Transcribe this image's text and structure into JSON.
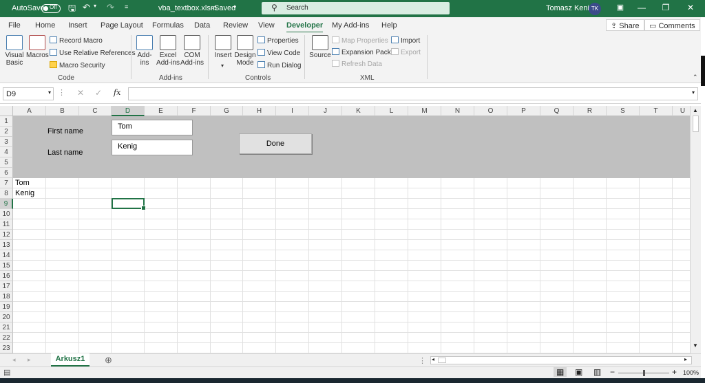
{
  "titlebar": {
    "autosave_label": "AutoSave",
    "autosave_state": "Off",
    "filename": "vba_textbox.xlsm",
    "saved_status": "Saved",
    "search_placeholder": "Search",
    "user_name": "Tomasz Kenig",
    "user_initials": "TK"
  },
  "tabs": [
    "File",
    "Home",
    "Insert",
    "Page Layout",
    "Formulas",
    "Data",
    "Review",
    "View",
    "Developer",
    "My Add-ins",
    "Help"
  ],
  "active_tab": "Developer",
  "share_label": "Share",
  "comments_label": "Comments",
  "ribbon": {
    "code": {
      "group_label": "Code",
      "visual_basic": "Visual Basic",
      "macros": "Macros",
      "record_macro": "Record Macro",
      "use_relative": "Use Relative References",
      "macro_security": "Macro Security"
    },
    "addins": {
      "group_label": "Add-ins",
      "addins": "Add-ins",
      "excel_addins": "Excel Add-ins",
      "com_addins": "COM Add-ins"
    },
    "controls": {
      "group_label": "Controls",
      "insert": "Insert",
      "design_mode": "Design Mode",
      "properties": "Properties",
      "view_code": "View Code",
      "run_dialog": "Run Dialog"
    },
    "xml": {
      "group_label": "XML",
      "source": "Source",
      "map_properties": "Map Properties",
      "expansion_packs": "Expansion Packs",
      "refresh_data": "Refresh Data",
      "import": "Import",
      "export": "Export"
    }
  },
  "formula_bar": {
    "name_box": "D9",
    "fx_label": "fx",
    "formula": ""
  },
  "columns": [
    "A",
    "B",
    "C",
    "D",
    "E",
    "F",
    "G",
    "H",
    "I",
    "J",
    "K",
    "L",
    "M",
    "N",
    "O",
    "P",
    "Q",
    "R",
    "S",
    "T",
    "U"
  ],
  "rows": [
    "1",
    "2",
    "3",
    "4",
    "5",
    "6",
    "7",
    "8",
    "9",
    "10",
    "11",
    "12",
    "13",
    "14",
    "15",
    "16",
    "17",
    "18",
    "19",
    "20",
    "21",
    "22",
    "23"
  ],
  "selected_column": "D",
  "selected_row": "9",
  "form": {
    "first_name_label": "First name",
    "last_name_label": "Last name",
    "first_name_value": "Tom",
    "last_name_value": "Kenig",
    "done_label": "Done"
  },
  "cells": {
    "A7": "Tom",
    "A8": "Kenig"
  },
  "sheet_tab": "Arkusz1",
  "status": {
    "zoom": "100%"
  },
  "colors": {
    "accent": "#217346",
    "form_band": "#c0c0c0"
  }
}
